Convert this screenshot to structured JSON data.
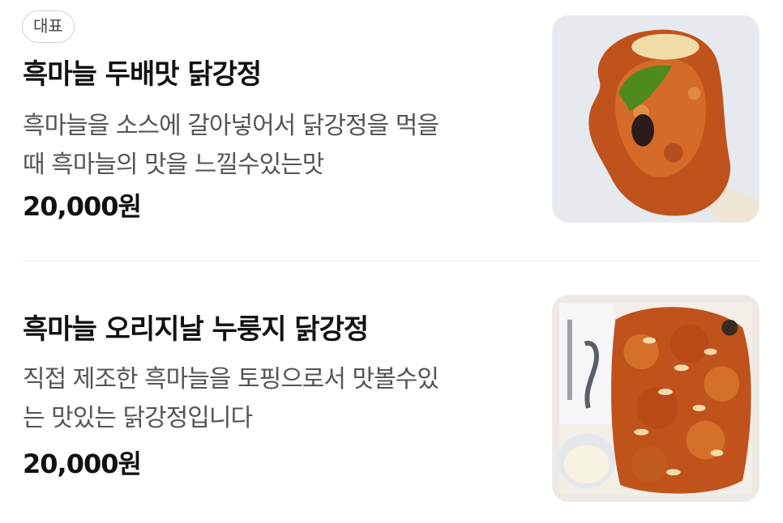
{
  "menu": {
    "items": [
      {
        "badge": "대표",
        "title": "흑마늘 두배맛 닭강정",
        "description_lines": [
          "흑마늘을 소스에 갈아넣어서 닭강정을 먹을",
          "때 흑마늘의 맛을 느낄수있는맛"
        ],
        "price": "20,000원",
        "image_icon": "chicken-bite-photo"
      },
      {
        "title": "흑마늘 오리지날 누룽지 닭강정",
        "description_lines": [
          "직접 제조한 흑마늘을 토핑으로서 맛볼수있",
          "는 맛있는 닭강정입니다"
        ],
        "price": "20,000원",
        "image_icon": "chicken-box-photo"
      }
    ]
  },
  "colors": {
    "title": "#111111",
    "description": "#555555",
    "badge_border": "#d4d4d4",
    "divider": "#ebebeb",
    "sauce": "#c0521c"
  }
}
